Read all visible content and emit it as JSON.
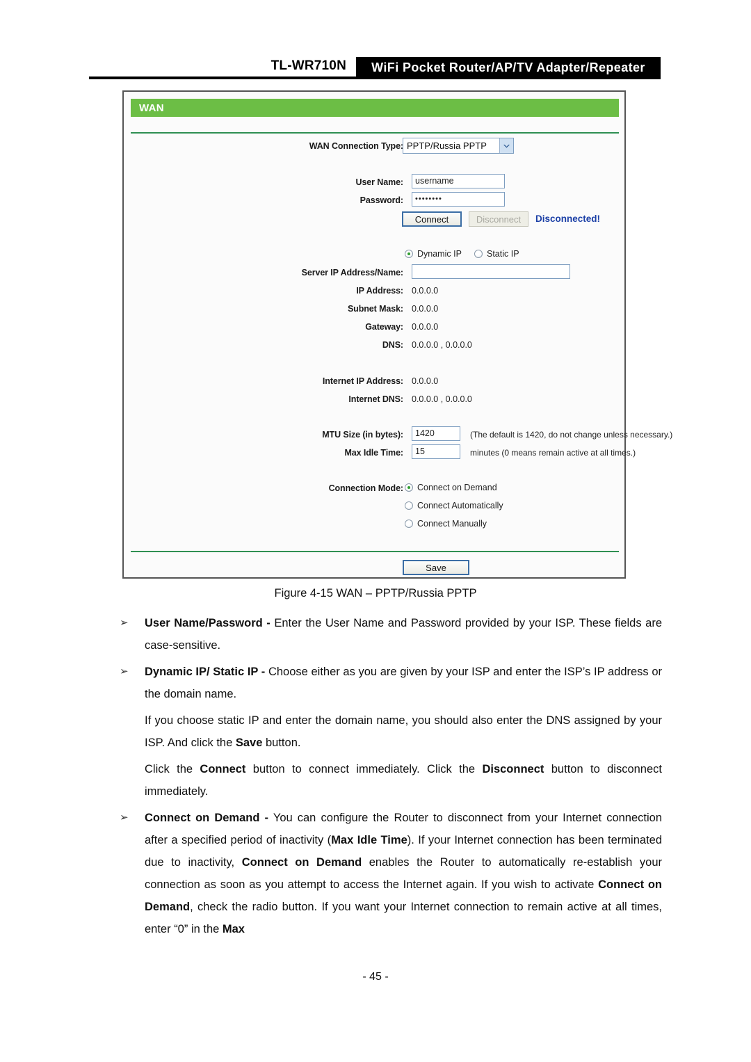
{
  "header": {
    "model": "TL-WR710N",
    "product": "WiFi Pocket Router/AP/TV Adapter/Repeater"
  },
  "panel": {
    "title": "WAN",
    "connection_type": {
      "label": "WAN Connection Type:",
      "value": "PPTP/Russia PPTP"
    },
    "credentials": {
      "username_label": "User Name:",
      "username_value": "username",
      "password_label": "Password:",
      "password_value": "••••••••"
    },
    "actions": {
      "connect_label": "Connect",
      "disconnect_label": "Disconnect",
      "status": "Disconnected!"
    },
    "ip_mode": {
      "dynamic_label": "Dynamic IP",
      "static_label": "Static IP",
      "selected": "Dynamic IP"
    },
    "server": {
      "label": "Server IP Address/Name:",
      "value": ""
    },
    "readouts": [
      {
        "label": "IP Address:",
        "value": "0.0.0.0"
      },
      {
        "label": "Subnet Mask:",
        "value": "0.0.0.0"
      },
      {
        "label": "Gateway:",
        "value": "0.0.0.0"
      },
      {
        "label": "DNS:",
        "value": "0.0.0.0 , 0.0.0.0"
      }
    ],
    "internet_readouts": [
      {
        "label": "Internet IP Address:",
        "value": "0.0.0.0"
      },
      {
        "label": "Internet DNS:",
        "value": "0.0.0.0 , 0.0.0.0"
      }
    ],
    "mtu": {
      "label": "MTU Size (in bytes):",
      "value": "1420",
      "hint": "(The default is 1420, do not change unless necessary.)"
    },
    "max_idle": {
      "label": "Max Idle Time:",
      "value": "15",
      "hint": "minutes (0 means remain active at all times.)"
    },
    "connection_mode": {
      "label": "Connection Mode:",
      "options": [
        "Connect on Demand",
        "Connect Automatically",
        "Connect Manually"
      ],
      "selected": "Connect on Demand"
    },
    "save_label": "Save"
  },
  "figure": {
    "caption": "Figure 4-15   WAN – PPTP/Russia PPTP"
  },
  "body": {
    "bullet_glyph": "➢",
    "paragraphs": [
      {
        "bulleted": true,
        "html": "<b>User Name/Password -</b> Enter the User Name and Password provided by your ISP. These fields are case-sensitive."
      },
      {
        "bulleted": true,
        "html": "<b>Dynamic IP/ Static IP -</b> Choose either as you are given by your ISP and enter the ISP’s IP address or the domain name."
      },
      {
        "bulleted": false,
        "html": "If you choose static IP and enter the domain name, you should also enter the DNS assigned by your ISP. And click the <b>Save</b> button."
      },
      {
        "bulleted": false,
        "html": "Click the <b>Connect</b> button to connect immediately. Click the <b>Disconnect</b> button to disconnect immediately."
      },
      {
        "bulleted": true,
        "html": "<b>Connect on Demand -</b> You can configure the Router to disconnect from your Internet connection after a specified period of inactivity (<b>Max Idle Time</b>). If your Internet connection has been terminated due to inactivity, <b>Connect on Demand</b> enables the Router to automatically re-establish your connection as soon as you attempt to access the Internet again. If you wish to activate <b>Connect on Demand</b>, check the radio button. If you want your Internet connection to remain active at all times, enter “0” in the <b>Max</b>"
      }
    ]
  },
  "footer": {
    "page_number": "- 45 -"
  },
  "colors": {
    "brand_green": "#6cbe45",
    "separator_green": "#2f8f52",
    "status_blue": "#1b3fa6"
  }
}
